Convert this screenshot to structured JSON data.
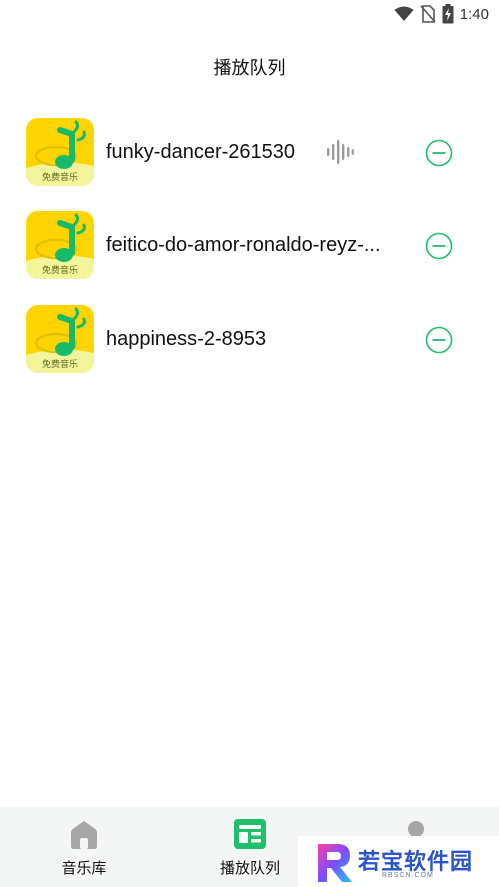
{
  "status_bar": {
    "time": "1:40",
    "icons": [
      "wifi-icon",
      "no-sim-icon",
      "battery-charging-icon"
    ]
  },
  "header": {
    "title": "播放队列"
  },
  "queue": {
    "items": [
      {
        "name": "funky-dancer-261530",
        "cover_label": "免费音乐",
        "playing": true
      },
      {
        "name": "feitico-do-amor-ronaldo-reyz-...",
        "cover_label": "免费音乐",
        "playing": false
      },
      {
        "name": "happiness-2-8953",
        "cover_label": "免费音乐",
        "playing": false
      }
    ]
  },
  "bottom_nav": {
    "items": [
      {
        "label": "音乐库",
        "icon": "home-icon",
        "active": false
      },
      {
        "label": "播放队列",
        "icon": "queue-icon",
        "active": true
      },
      {
        "label": "",
        "icon": "profile-icon",
        "active": false
      }
    ]
  },
  "watermark": {
    "text": "若宝软件园",
    "sub": "RBSCN.COM"
  },
  "colors": {
    "accent": "#1fbf6b",
    "cover_bg": "#ffd400",
    "nav_bg": "#f4f6f5",
    "wave": "#9a9a9a"
  }
}
